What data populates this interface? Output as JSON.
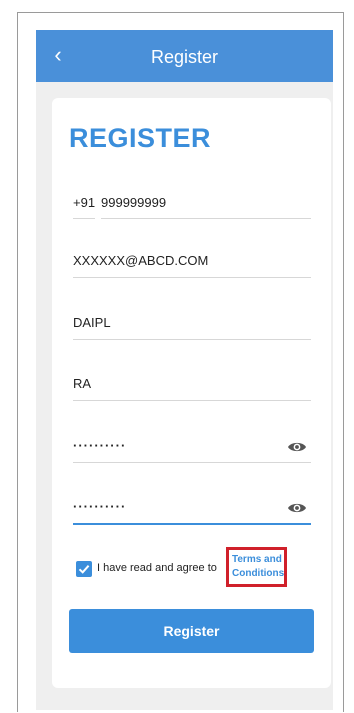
{
  "header": {
    "back_icon": "chevron-left-icon",
    "title": "Register"
  },
  "form": {
    "heading": "REGISTER",
    "country_code": "+91",
    "phone": "999999999",
    "email": "XXXXXX@ABCD.COM",
    "company": "DAIPL",
    "role": "RA",
    "password": "··········",
    "confirm_password": "··········",
    "password_icon": "eye-icon",
    "agree_checked": true,
    "agree_text": "I have read and agree to",
    "terms_link": "Terms and Conditions",
    "register_label": "Register"
  },
  "colors": {
    "accent": "#3b8edb",
    "appbar": "#4a90d9",
    "highlight_box": "#d0202a"
  }
}
